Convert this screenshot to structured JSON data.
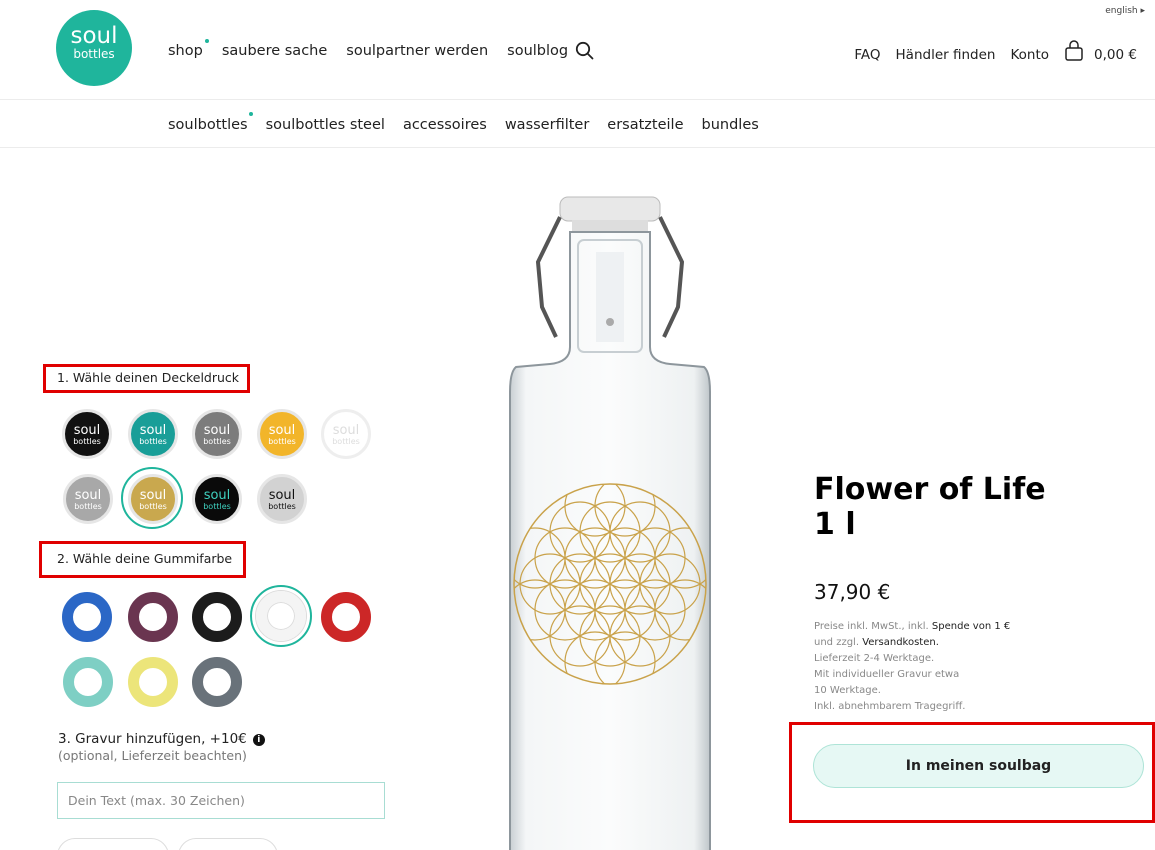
{
  "header": {
    "language_label": "english ▸",
    "logo": {
      "line1": "soul",
      "line2": "bottles",
      "color": "#1fb59c"
    },
    "main_nav": [
      "shop",
      "saubere sache",
      "soulpartner werden",
      "soulblog"
    ],
    "right_nav": {
      "faq": "FAQ",
      "dealer": "Händler finden",
      "account": "Konto",
      "cart_amount": "0,00 €"
    },
    "icons": {
      "search": "search-icon",
      "cart": "shopping-bag-icon"
    }
  },
  "sub_nav": [
    "soulbottles",
    "soulbottles steel",
    "accessoires",
    "wasserfilter",
    "ersatzteile",
    "bundles"
  ],
  "configurator": {
    "step1_label": "1. Wähle deinen Deckeldruck",
    "caps": [
      {
        "text1": "soul",
        "text2": "bottles",
        "bg": "#111111",
        "fg": "#ffffff",
        "selected": false
      },
      {
        "text1": "soul",
        "text2": "bottles",
        "bg": "#199e98",
        "fg": "#ffffff",
        "selected": false
      },
      {
        "text1": "soul",
        "text2": "bottles",
        "bg": "#7c7c7c",
        "fg": "#ffffff",
        "selected": false
      },
      {
        "text1": "soul",
        "text2": "bottles",
        "bg": "#f2b52a",
        "fg": "#ffffff",
        "selected": false
      },
      {
        "text1": "soul",
        "text2": "bottles",
        "bg": "#ffffff",
        "fg": "#dddddd",
        "selected": false
      },
      {
        "text1": "soul",
        "text2": "bottles",
        "bg": "#a8a8a8",
        "fg": "#ffffff",
        "selected": false
      },
      {
        "text1": "soul",
        "text2": "bottles",
        "bg": "#c9a84e",
        "fg": "#ffffff",
        "selected": true
      },
      {
        "text1": "soul",
        "text2": "bottles",
        "bg": "#0a0a0a",
        "fg": "#3fd2c0",
        "selected": false
      },
      {
        "text1": "soul",
        "text2": "bottles",
        "bg": "#d2d2d2",
        "fg": "#111111",
        "selected": false
      }
    ],
    "step2_label": "2. Wähle deine Gummifarbe",
    "rubber_colors": [
      {
        "color": "#2b67c6",
        "selected": false
      },
      {
        "color": "#6a3550",
        "selected": false
      },
      {
        "color": "#1c1c1c",
        "selected": false
      },
      {
        "color": "#f4f4f4",
        "selected": true
      },
      {
        "color": "#cc2727",
        "selected": false
      },
      {
        "color": "#7ecfc4",
        "selected": false
      },
      {
        "color": "#ece57a",
        "selected": false
      },
      {
        "color": "#69727a",
        "selected": false
      }
    ],
    "step3_label": "3. Gravur hinzufügen, +10€",
    "step3_hint": "(optional, Lieferzeit beachten)",
    "engrave_placeholder": "Dein Text (max. 30 Zeichen)",
    "info_icon": "info-icon"
  },
  "product": {
    "title_line1": "Flower of Life",
    "title_line2": "1 l",
    "price": "37,90 €",
    "fine_print": {
      "l1a": "Preise inkl. MwSt., inkl. ",
      "l1b": "Spende von 1 €",
      "l2a": "und zzgl. ",
      "l2b": "Versandkosten.",
      "l3": "Lieferzeit 2-4 Werktage.",
      "l4": "Mit individueller Gravur etwa",
      "l5": "10 Werktage.",
      "l6": "Inkl. abnehmbarem Tragegriff."
    },
    "add_to_cart": "In meinen soulbag",
    "image": "flower-of-life-bottle"
  }
}
